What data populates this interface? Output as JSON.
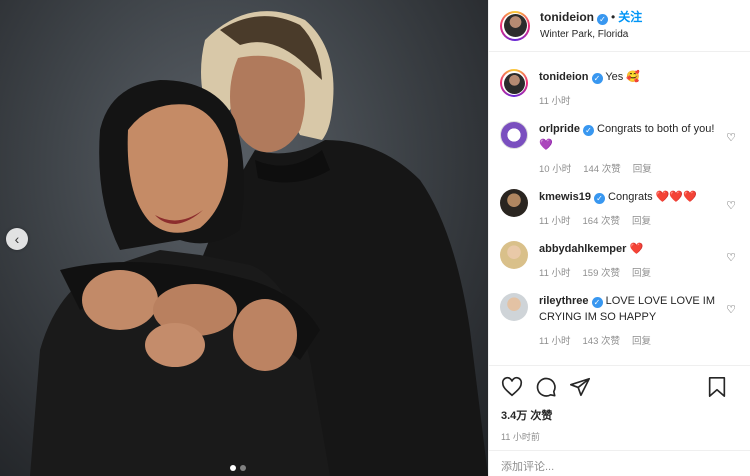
{
  "post": {
    "username": "tonideion",
    "follow_label": "关注",
    "separator": "•",
    "location": "Winter Park, Florida",
    "likes": "3.4万 次赞",
    "time": "11 小时前"
  },
  "caption": {
    "username": "tonideion",
    "text": "Yes 🥰",
    "time": "11 小时"
  },
  "comments": [
    {
      "username": "orlpride",
      "text": "Congrats to both of you! 💜",
      "time": "10 小时",
      "likes": "144 次赞",
      "reply": "回复"
    },
    {
      "username": "kmewis19",
      "text": "Congrats ❤️❤️❤️",
      "time": "11 小时",
      "likes": "164 次赞",
      "reply": "回复"
    },
    {
      "username": "abbydahlkemper",
      "text": "❤️",
      "time": "11 小时",
      "likes": "159 次赞",
      "reply": "回复"
    },
    {
      "username": "rileythree",
      "text": "LOVE LOVE LOVE IM CRYING IM SO HAPPY",
      "time": "11 小时",
      "likes": "143 次赞",
      "reply": "回复"
    }
  ],
  "comment_input": {
    "placeholder": "添加评论..."
  },
  "carousel": {
    "current": 1,
    "total": 2
  },
  "colors": {
    "accent": "#0095f6",
    "verified": "#3897f0",
    "muted": "#8e8e8e"
  },
  "icons": [
    "chevron-left-icon",
    "verified-badge-icon",
    "heart-icon",
    "comment-icon",
    "share-icon",
    "bookmark-icon"
  ]
}
